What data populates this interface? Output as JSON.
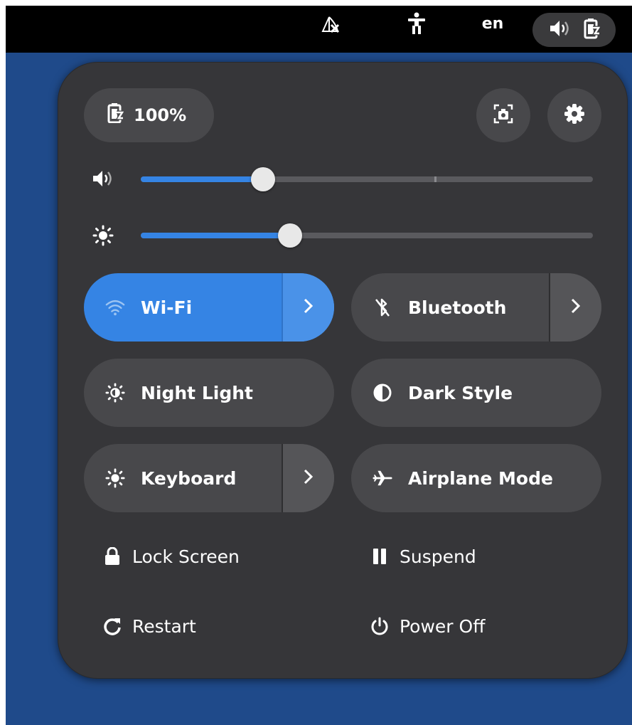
{
  "topbar": {
    "language": "en",
    "icons": [
      "network-disconnected-icon",
      "accessibility-icon",
      "volume-icon",
      "battery-icon"
    ]
  },
  "quick_settings": {
    "battery": {
      "label": "100%",
      "icon": "battery-charging-icon"
    },
    "buttons": [
      {
        "name": "screenshot",
        "icon": "screenshot-icon"
      },
      {
        "name": "settings",
        "icon": "gear-icon"
      }
    ],
    "sliders": {
      "volume": {
        "icon": "volume-icon",
        "level": 0.27,
        "mark": 0.65
      },
      "brightness": {
        "icon": "brightness-icon",
        "level": 0.33
      }
    },
    "toggles": [
      {
        "label": "Wi-Fi",
        "icon": "wifi-icon",
        "active": true,
        "has_menu": true
      },
      {
        "label": "Bluetooth",
        "icon": "bluetooth-disabled-icon",
        "active": false,
        "has_menu": true
      },
      {
        "label": "Night Light",
        "icon": "night-light-icon",
        "active": false,
        "has_menu": false
      },
      {
        "label": "Dark Style",
        "icon": "dark-style-icon",
        "active": false,
        "has_menu": false
      },
      {
        "label": "Keyboard",
        "icon": "keyboard-brightness-icon",
        "active": false,
        "has_menu": true
      },
      {
        "label": "Airplane Mode",
        "icon": "airplane-icon",
        "active": false,
        "has_menu": false
      }
    ],
    "actions": {
      "lock": "Lock Screen",
      "suspend": "Suspend",
      "restart": "Restart",
      "power_off": "Power Off"
    }
  },
  "colors": {
    "accent": "#3584e4",
    "panel_bg": "#363639",
    "button_bg": "#48484b",
    "desktop_bg": "#1f4a8a"
  }
}
